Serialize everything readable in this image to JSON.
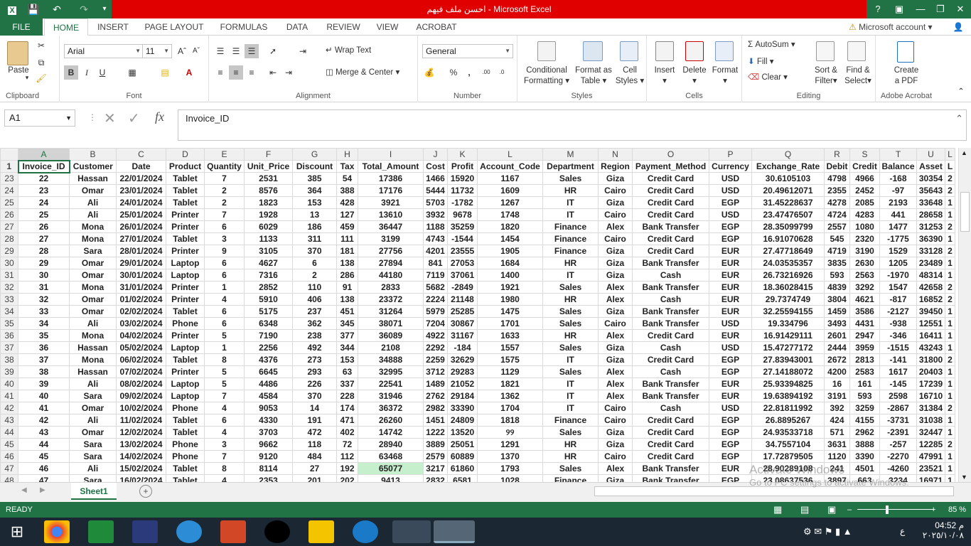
{
  "window": {
    "title": "احسن ملف فيهم  -  Microsoft Excel",
    "account": "Microsoft account"
  },
  "tabs": [
    "FILE",
    "HOME",
    "INSERT",
    "PAGE LAYOUT",
    "FORMULAS",
    "DATA",
    "REVIEW",
    "VIEW",
    "ACROBAT"
  ],
  "ribbon": {
    "clipboard": {
      "label": "Clipboard",
      "paste": "Paste"
    },
    "font": {
      "label": "Font",
      "name": "Arial",
      "size": "11"
    },
    "alignment": {
      "label": "Alignment",
      "wrap": "Wrap Text",
      "merge": "Merge & Center"
    },
    "number": {
      "label": "Number",
      "format": "General"
    },
    "styles": {
      "label": "Styles",
      "cond1": "Conditional",
      "cond2": "Formatting",
      "fmt1": "Format as",
      "fmt2": "Table",
      "cell1": "Cell",
      "cell2": "Styles"
    },
    "cells": {
      "label": "Cells",
      "insert": "Insert",
      "delete": "Delete",
      "format": "Format"
    },
    "editing": {
      "label": "Editing",
      "autosum": "AutoSum",
      "fill": "Fill",
      "clear": "Clear",
      "sort1": "Sort &",
      "sort2": "Filter",
      "find1": "Find &",
      "find2": "Select"
    },
    "acrobat": {
      "label": "Adobe Acrobat",
      "create1": "Create",
      "create2": "a PDF"
    }
  },
  "formula_bar": {
    "name_box": "A1",
    "formula": "Invoice_ID"
  },
  "columns": [
    "A",
    "B",
    "C",
    "D",
    "E",
    "F",
    "G",
    "H",
    "I",
    "J",
    "K",
    "L",
    "M",
    "N",
    "O",
    "P",
    "Q",
    "R",
    "S",
    "T",
    "U",
    "L"
  ],
  "headers": [
    "Invoice_ID",
    "Customer",
    "Date",
    "Product",
    "Quantity",
    "Unit_Price",
    "Discount",
    "Tax",
    "Total_Amount",
    "Cost",
    "Profit",
    "Account_Code",
    "Department",
    "Region",
    "Payment_Method",
    "Currency",
    "Exchange_Rate",
    "Debit",
    "Credit",
    "Balance",
    "Asset",
    "L"
  ],
  "rows": [
    [
      "23",
      "22",
      "Hassan",
      "22/01/2024",
      "Tablet",
      "7",
      "2531",
      "385",
      "54",
      "17386",
      "1466",
      "15920",
      "1167",
      "Sales",
      "Giza",
      "Credit Card",
      "USD",
      "30.6105103",
      "4798",
      "4966",
      "-168",
      "30354",
      "2"
    ],
    [
      "24",
      "23",
      "Omar",
      "23/01/2024",
      "Tablet",
      "2",
      "8576",
      "364",
      "388",
      "17176",
      "5444",
      "11732",
      "1609",
      "HR",
      "Cairo",
      "Credit Card",
      "USD",
      "20.49612071",
      "2355",
      "2452",
      "-97",
      "35643",
      "2"
    ],
    [
      "25",
      "24",
      "Ali",
      "24/01/2024",
      "Tablet",
      "2",
      "1823",
      "153",
      "428",
      "3921",
      "5703",
      "-1782",
      "1267",
      "IT",
      "Giza",
      "Credit Card",
      "EGP",
      "31.45228637",
      "4278",
      "2085",
      "2193",
      "33648",
      "1"
    ],
    [
      "26",
      "25",
      "Ali",
      "25/01/2024",
      "Printer",
      "7",
      "1928",
      "13",
      "127",
      "13610",
      "3932",
      "9678",
      "1748",
      "IT",
      "Cairo",
      "Credit Card",
      "USD",
      "23.47476507",
      "4724",
      "4283",
      "441",
      "28658",
      "1"
    ],
    [
      "27",
      "26",
      "Mona",
      "26/01/2024",
      "Printer",
      "6",
      "6029",
      "186",
      "459",
      "36447",
      "1188",
      "35259",
      "1820",
      "Finance",
      "Alex",
      "Bank Transfer",
      "EGP",
      "28.35099799",
      "2557",
      "1080",
      "1477",
      "31253",
      "2"
    ],
    [
      "28",
      "27",
      "Mona",
      "27/01/2024",
      "Tablet",
      "3",
      "1133",
      "311",
      "111",
      "3199",
      "4743",
      "-1544",
      "1454",
      "Finance",
      "Cairo",
      "Credit Card",
      "EGP",
      "16.91070628",
      "545",
      "2320",
      "-1775",
      "36390",
      "1"
    ],
    [
      "29",
      "28",
      "Sara",
      "28/01/2024",
      "Printer",
      "9",
      "3105",
      "370",
      "181",
      "27756",
      "4201",
      "23555",
      "1905",
      "Finance",
      "Giza",
      "Credit Card",
      "EUR",
      "27.47718649",
      "4719",
      "3190",
      "1529",
      "33128",
      "2"
    ],
    [
      "30",
      "29",
      "Omar",
      "29/01/2024",
      "Laptop",
      "6",
      "4627",
      "6",
      "138",
      "27894",
      "841",
      "27053",
      "1684",
      "HR",
      "Giza",
      "Bank Transfer",
      "EUR",
      "24.03535357",
      "3835",
      "2630",
      "1205",
      "23489",
      "1"
    ],
    [
      "31",
      "30",
      "Omar",
      "30/01/2024",
      "Laptop",
      "6",
      "7316",
      "2",
      "286",
      "44180",
      "7119",
      "37061",
      "1400",
      "IT",
      "Giza",
      "Cash",
      "EUR",
      "26.73216926",
      "593",
      "2563",
      "-1970",
      "48314",
      "1"
    ],
    [
      "32",
      "31",
      "Mona",
      "31/01/2024",
      "Printer",
      "1",
      "2852",
      "110",
      "91",
      "2833",
      "5682",
      "-2849",
      "1921",
      "Sales",
      "Alex",
      "Bank Transfer",
      "EUR",
      "18.36028415",
      "4839",
      "3292",
      "1547",
      "42658",
      "2"
    ],
    [
      "33",
      "32",
      "Omar",
      "01/02/2024",
      "Printer",
      "4",
      "5910",
      "406",
      "138",
      "23372",
      "2224",
      "21148",
      "1980",
      "HR",
      "Alex",
      "Cash",
      "EUR",
      "29.7374749",
      "3804",
      "4621",
      "-817",
      "16852",
      "2"
    ],
    [
      "34",
      "33",
      "Omar",
      "02/02/2024",
      "Tablet",
      "6",
      "5175",
      "237",
      "451",
      "31264",
      "5979",
      "25285",
      "1475",
      "Sales",
      "Giza",
      "Bank Transfer",
      "EUR",
      "32.25594155",
      "1459",
      "3586",
      "-2127",
      "39450",
      "1"
    ],
    [
      "35",
      "34",
      "Ali",
      "03/02/2024",
      "Phone",
      "6",
      "6348",
      "362",
      "345",
      "38071",
      "7204",
      "30867",
      "1701",
      "Sales",
      "Cairo",
      "Bank Transfer",
      "USD",
      "19.334796",
      "3493",
      "4431",
      "-938",
      "12551",
      "1"
    ],
    [
      "36",
      "35",
      "Mona",
      "04/02/2024",
      "Printer",
      "5",
      "7190",
      "238",
      "377",
      "36089",
      "4922",
      "31167",
      "1633",
      "HR",
      "Alex",
      "Credit Card",
      "EUR",
      "16.91429111",
      "2601",
      "2947",
      "-346",
      "16411",
      "1"
    ],
    [
      "37",
      "36",
      "Hassan",
      "05/02/2024",
      "Laptop",
      "1",
      "2256",
      "492",
      "344",
      "2108",
      "2292",
      "-184",
      "1557",
      "Sales",
      "Giza",
      "Cash",
      "USD",
      "15.47277172",
      "2444",
      "3959",
      "-1515",
      "43243",
      "1"
    ],
    [
      "38",
      "37",
      "Mona",
      "06/02/2024",
      "Tablet",
      "8",
      "4376",
      "273",
      "153",
      "34888",
      "2259",
      "32629",
      "1575",
      "IT",
      "Giza",
      "Credit Card",
      "EGP",
      "27.83943001",
      "2672",
      "2813",
      "-141",
      "31800",
      "2"
    ],
    [
      "39",
      "38",
      "Hassan",
      "07/02/2024",
      "Printer",
      "5",
      "6645",
      "293",
      "63",
      "32995",
      "3712",
      "29283",
      "1129",
      "Sales",
      "Alex",
      "Cash",
      "EGP",
      "27.14188072",
      "4200",
      "2583",
      "1617",
      "20403",
      "1"
    ],
    [
      "40",
      "39",
      "Ali",
      "08/02/2024",
      "Laptop",
      "5",
      "4486",
      "226",
      "337",
      "22541",
      "1489",
      "21052",
      "1821",
      "IT",
      "Alex",
      "Bank Transfer",
      "EUR",
      "25.93394825",
      "16",
      "161",
      "-145",
      "17239",
      "1"
    ],
    [
      "41",
      "40",
      "Sara",
      "09/02/2024",
      "Laptop",
      "7",
      "4584",
      "370",
      "228",
      "31946",
      "2762",
      "29184",
      "1362",
      "IT",
      "Alex",
      "Bank Transfer",
      "EUR",
      "19.63894192",
      "3191",
      "593",
      "2598",
      "16710",
      "1"
    ],
    [
      "42",
      "41",
      "Omar",
      "10/02/2024",
      "Phone",
      "4",
      "9053",
      "14",
      "174",
      "36372",
      "2982",
      "33390",
      "1704",
      "IT",
      "Cairo",
      "Cash",
      "USD",
      "22.81811992",
      "392",
      "3259",
      "-2867",
      "31384",
      "2"
    ],
    [
      "43",
      "42",
      "Ali",
      "11/02/2024",
      "Tablet",
      "6",
      "4330",
      "191",
      "471",
      "26260",
      "1451",
      "24809",
      "1818",
      "Finance",
      "Cairo",
      "Credit Card",
      "EGP",
      "26.8895267",
      "424",
      "4155",
      "-3731",
      "31038",
      "1"
    ],
    [
      "44",
      "43",
      "Omar",
      "12/02/2024",
      "Tablet",
      "4",
      "3703",
      "472",
      "402",
      "14742",
      "1222",
      "13520",
      "୨୨",
      "Sales",
      "Giza",
      "Credit Card",
      "EGP",
      "24.93533718",
      "571",
      "2962",
      "-2391",
      "32447",
      "1"
    ],
    [
      "45",
      "44",
      "Sara",
      "13/02/2024",
      "Phone",
      "3",
      "9662",
      "118",
      "72",
      "28940",
      "3889",
      "25051",
      "1291",
      "HR",
      "Giza",
      "Credit Card",
      "EGP",
      "34.7557104",
      "3631",
      "3888",
      "-257",
      "12285",
      "2"
    ],
    [
      "46",
      "45",
      "Sara",
      "14/02/2024",
      "Phone",
      "7",
      "9120",
      "484",
      "112",
      "63468",
      "2579",
      "60889",
      "1370",
      "HR",
      "Cairo",
      "Credit Card",
      "EGP",
      "17.72879505",
      "1120",
      "3390",
      "-2270",
      "47991",
      "1"
    ],
    [
      "47",
      "46",
      "Ali",
      "15/02/2024",
      "Tablet",
      "8",
      "8114",
      "27",
      "192",
      "65077",
      "3217",
      "61860",
      "1793",
      "Sales",
      "Alex",
      "Bank Transfer",
      "EUR",
      "28.90289108",
      "241",
      "4501",
      "-4260",
      "23521",
      "1"
    ],
    [
      "48",
      "47",
      "Sara",
      "16/02/2024",
      "Tablet",
      "4",
      "2353",
      "201",
      "202",
      "9413",
      "2832",
      "6581",
      "1028",
      "Finance",
      "Giza",
      "Bank Transfer",
      "EGP",
      "23.08637536",
      "3897",
      "663",
      "3234",
      "16971",
      "1"
    ]
  ],
  "sheet": {
    "tab": "Sheet1"
  },
  "status": {
    "ready": "READY",
    "zoom": "85 %"
  },
  "watermark": {
    "line1": "Activate Windows",
    "line2": "Go to PC settings to activate Windows."
  },
  "clock": {
    "time": "04:52 م",
    "date": "٢٠٢٥/١٠/٠٨",
    "lang": "ع"
  }
}
